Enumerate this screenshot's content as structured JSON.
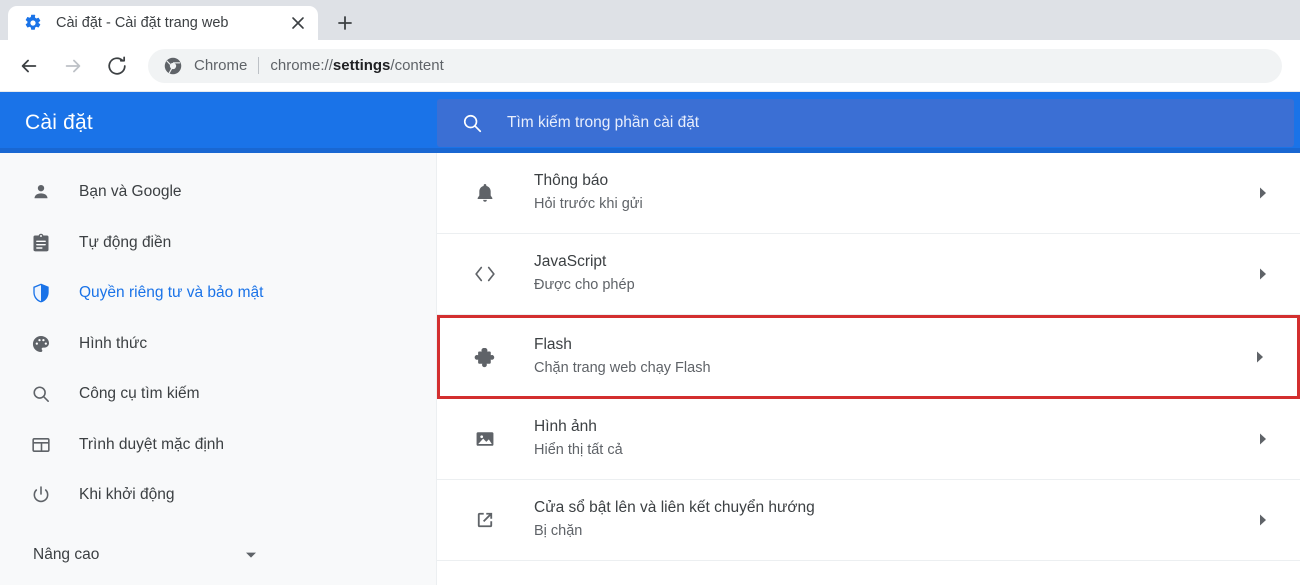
{
  "browser": {
    "tab": {
      "title": "Cài đặt - Cài đặt trang web",
      "favicon": "gear-icon",
      "close": "close-icon"
    },
    "new_tab_label": "+",
    "nav": {
      "back": "back-arrow-icon",
      "forward": "forward-arrow-icon",
      "reload": "reload-icon"
    },
    "omnibox": {
      "icon": "chrome-logo-icon",
      "scheme_label": "Chrome",
      "url_prefix": "chrome://",
      "url_bold": "settings",
      "url_suffix": "/content",
      "full_url": "chrome://settings/content"
    }
  },
  "settings_header": {
    "title": "Cài đặt",
    "search_placeholder": "Tìm kiếm trong phần cài đặt",
    "search_icon": "search-icon",
    "bg_color": "#1a73e8",
    "search_bg_color": "#3b6fd4"
  },
  "sidebar": {
    "items": [
      {
        "label": "Bạn và Google",
        "icon": "person-icon",
        "active": false
      },
      {
        "label": "Tự động điền",
        "icon": "clipboard-icon",
        "active": false
      },
      {
        "label": "Quyền riêng tư và bảo mật",
        "icon": "shield-icon",
        "active": true
      },
      {
        "label": "Hình thức",
        "icon": "palette-icon",
        "active": false
      },
      {
        "label": "Công cụ tìm kiếm",
        "icon": "search-icon",
        "active": false
      },
      {
        "label": "Trình duyệt mặc định",
        "icon": "browser-window-icon",
        "active": false
      },
      {
        "label": "Khi khởi động",
        "icon": "power-icon",
        "active": false
      }
    ],
    "advanced": {
      "label": "Nâng cao",
      "caret": "chevron-down-icon"
    },
    "active_color": "#1a73e8"
  },
  "main": {
    "rows": [
      {
        "title": "Thông báo",
        "subtitle": "Hỏi trước khi gửi",
        "icon": "bell-icon",
        "chevron": "chevron-right-icon",
        "highlighted": false
      },
      {
        "title": "JavaScript",
        "subtitle": "Được cho phép",
        "icon": "code-brackets-icon",
        "chevron": "chevron-right-icon",
        "highlighted": false
      },
      {
        "title": "Flash",
        "subtitle": "Chặn trang web chạy Flash",
        "icon": "puzzle-piece-icon",
        "chevron": "chevron-right-icon",
        "highlighted": true
      },
      {
        "title": "Hình ảnh",
        "subtitle": "Hiển thị tất cả",
        "icon": "image-icon",
        "chevron": "chevron-right-icon",
        "highlighted": false
      },
      {
        "title": "Cửa sổ bật lên và liên kết chuyển hướng",
        "subtitle": "Bị chặn",
        "icon": "external-link-icon",
        "chevron": "chevron-right-icon",
        "highlighted": false
      }
    ],
    "highlight_color": "#d32f2f"
  }
}
